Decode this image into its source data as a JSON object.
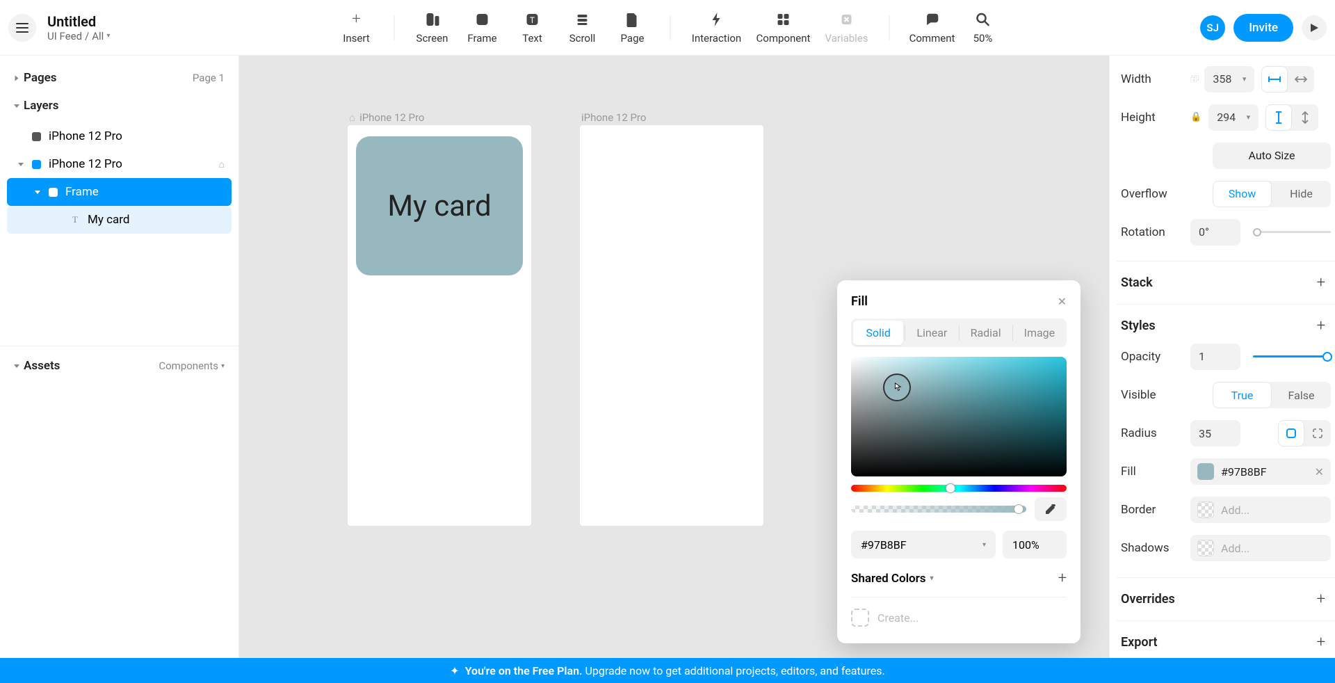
{
  "header": {
    "title": "Untitled",
    "breadcrumb_project": "UI Feed",
    "breadcrumb_sep": "/",
    "breadcrumb_page": "All",
    "avatar_initials": "SJ",
    "invite_label": "Invite",
    "zoom": "50%"
  },
  "tools": {
    "insert": "Insert",
    "screen": "Screen",
    "frame": "Frame",
    "text": "Text",
    "scroll": "Scroll",
    "page": "Page",
    "interaction": "Interaction",
    "component": "Component",
    "variables": "Variables",
    "comment": "Comment",
    "search": "Search"
  },
  "leftPanel": {
    "pages_title": "Pages",
    "page_label": "Page 1",
    "layers_title": "Layers",
    "assets_title": "Assets",
    "assets_sub": "Components",
    "layers": {
      "l0": "iPhone 12 Pro",
      "l1": "iPhone 12 Pro",
      "l2": "Frame",
      "l3": "My card"
    }
  },
  "canvas": {
    "artboard1_label": "iPhone 12 Pro",
    "artboard2_label": "iPhone 12 Pro",
    "card_text": "My card"
  },
  "rightPanel": {
    "width_label": "Width",
    "width_value": "358",
    "height_label": "Height",
    "height_value": "294",
    "autosize": "Auto Size",
    "overflow_label": "Overflow",
    "overflow_show": "Show",
    "overflow_hide": "Hide",
    "rotation_label": "Rotation",
    "rotation_value": "0°",
    "stack_title": "Stack",
    "styles_title": "Styles",
    "opacity_label": "Opacity",
    "opacity_value": "1",
    "visible_label": "Visible",
    "visible_true": "True",
    "visible_false": "False",
    "radius_label": "Radius",
    "radius_value": "35",
    "fill_label": "Fill",
    "fill_hex": "#97B8BF",
    "border_label": "Border",
    "border_add": "Add...",
    "shadows_label": "Shadows",
    "shadows_add": "Add...",
    "overrides_title": "Overrides",
    "export_title": "Export"
  },
  "colorPopup": {
    "title": "Fill",
    "tab_solid": "Solid",
    "tab_linear": "Linear",
    "tab_radial": "Radial",
    "tab_image": "Image",
    "hex": "#97B8BF",
    "alpha": "100%",
    "shared_title": "Shared Colors",
    "create": "Create..."
  },
  "banner": {
    "bold": "You're on the Free Plan.",
    "rest": "Upgrade now to get additional projects, editors, and features."
  }
}
